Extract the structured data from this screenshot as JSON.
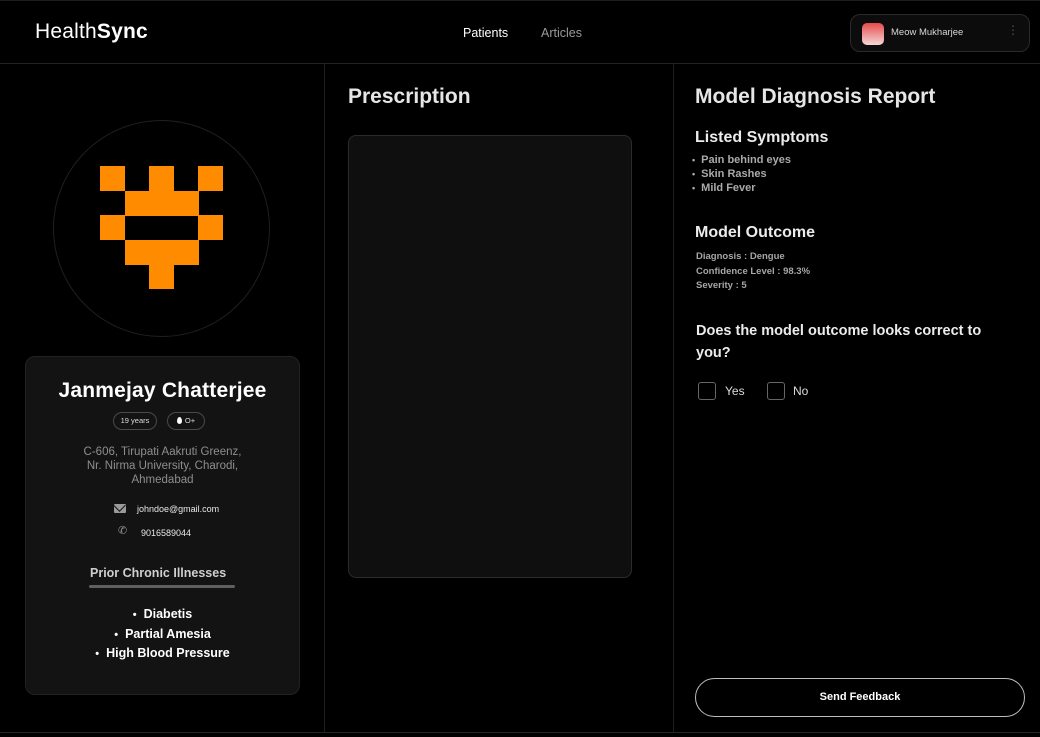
{
  "app": {
    "logo_light": "Health",
    "logo_bold": "Sync"
  },
  "nav": {
    "patients": "Patients",
    "articles": "Articles"
  },
  "user": {
    "name": "Meow Mukharjee",
    "menu_icon": "⋮"
  },
  "patient": {
    "name": "Janmejay Chatterjee",
    "age": "19 years",
    "blood_group": "O+",
    "address": [
      "C-606, Tirupati Aakruti Greenz,",
      "Nr. Nirma University, Charodi,",
      "Ahmedabad"
    ],
    "email": "johndoe@gmail.com",
    "phone": "9016589044",
    "chronic_title": "Prior Chronic Illnesses",
    "chronic_illnesses": [
      "Diabetis",
      "Partial Amesia",
      "High Blood Pressure"
    ]
  },
  "prescription": {
    "title": "Prescription"
  },
  "report": {
    "title": "Model Diagnosis Report",
    "symptoms_title": "Listed Symptoms",
    "symptoms": [
      "Pain behind eyes",
      "Skin Rashes",
      "Mild Fever"
    ],
    "outcome_title": "Model Outcome",
    "diagnosis": "Diagnosis : Dengue",
    "confidence": "Confidence Level : 98.3%",
    "severity": "Severity : 5",
    "question": "Does the model outcome looks correct to you?",
    "yes_label": "Yes",
    "no_label": "No",
    "send_label": "Send Feedback"
  },
  "colors": {
    "accent": "#ff8c00",
    "background": "#000000",
    "card": "#131313"
  },
  "icons": {
    "email": "mail-icon",
    "phone": "phone-icon",
    "blood": "drop-icon"
  }
}
